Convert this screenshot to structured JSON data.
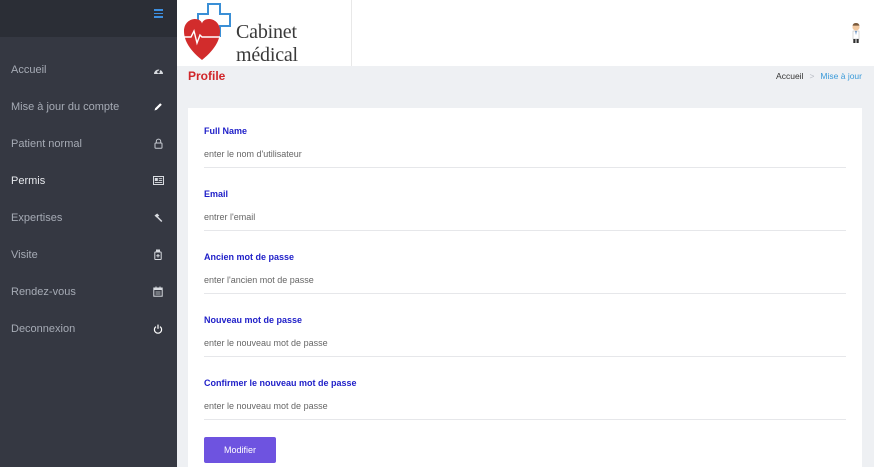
{
  "app": {
    "title": "Cabinet médical"
  },
  "sidebar": {
    "items": [
      {
        "label": "Accueil",
        "icon": "dashboard-icon"
      },
      {
        "label": "Mise à jour du compte",
        "icon": "pencil-icon"
      },
      {
        "label": "Patient normal",
        "icon": "lock-icon"
      },
      {
        "label": "Permis",
        "icon": "id-card-icon",
        "active": true
      },
      {
        "label": "Expertises",
        "icon": "hammer-icon"
      },
      {
        "label": "Visite",
        "icon": "medicine-icon"
      },
      {
        "label": "Rendez-vous",
        "icon": "calendar-icon"
      },
      {
        "label": "Deconnexion",
        "icon": "power-icon"
      }
    ]
  },
  "page": {
    "title": "Profile",
    "breadcrumb": {
      "home": "Accueil",
      "separator": ">",
      "current": "Mise à jour"
    }
  },
  "form": {
    "fields": [
      {
        "label": "Full Name",
        "placeholder": "enter le nom d'utilisateur",
        "value": ""
      },
      {
        "label": "Email",
        "placeholder": "entrer l'email",
        "value": ""
      },
      {
        "label": "Ancien mot de passe",
        "placeholder": "enter l'ancien mot de passe",
        "value": ""
      },
      {
        "label": "Nouveau mot de passe",
        "placeholder": "enter le nouveau mot de passe",
        "value": ""
      },
      {
        "label": "Confirmer le nouveau mot de passe",
        "placeholder": "enter le nouveau mot de passe",
        "value": ""
      }
    ],
    "submit_label": "Modifier"
  },
  "colors": {
    "sidebar_bg": "#353842",
    "accent": "#6e53e0",
    "label": "#1e1ec8",
    "title": "#d0262a",
    "breadcrumb_active": "#3a9ad9"
  }
}
